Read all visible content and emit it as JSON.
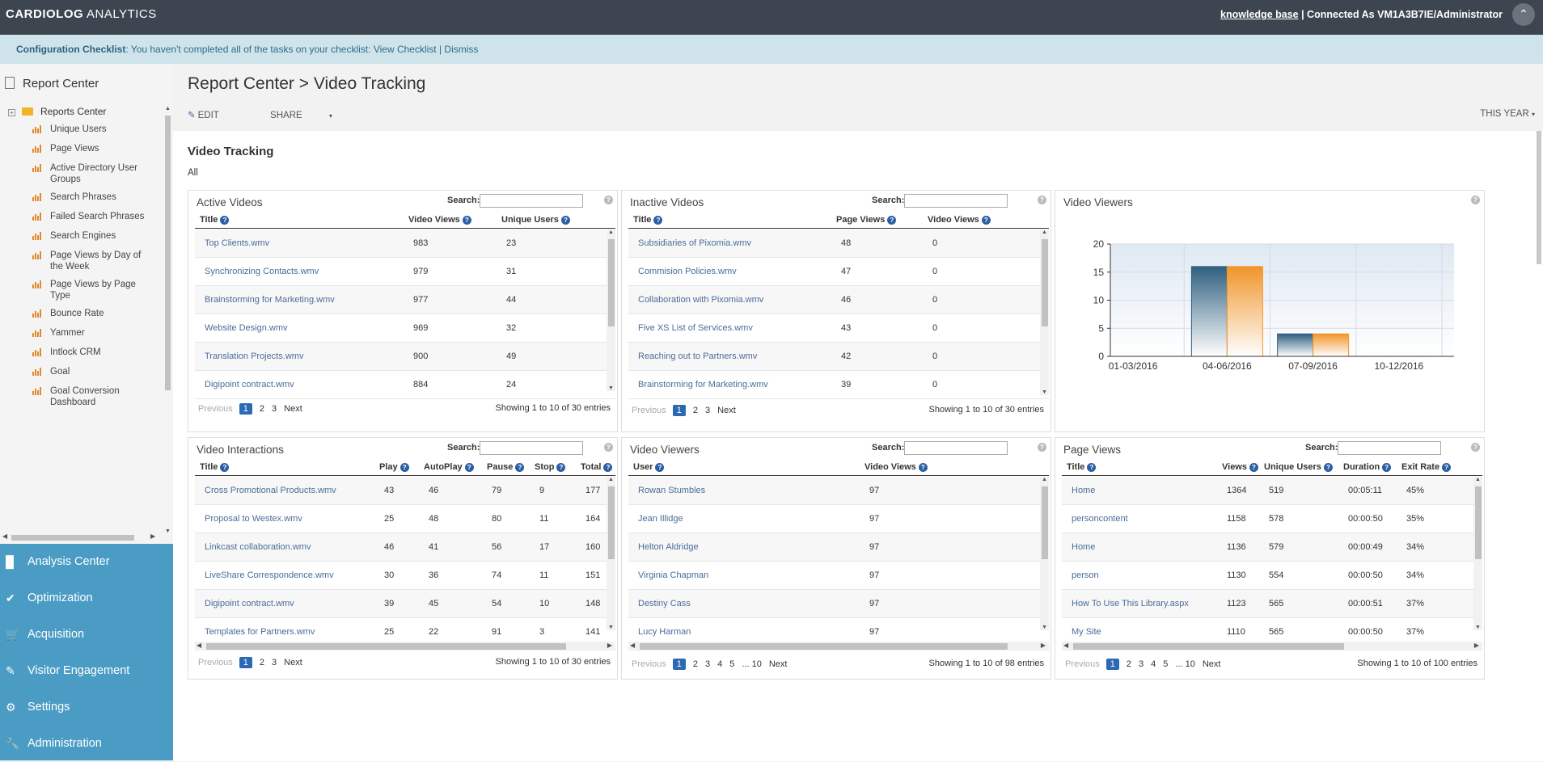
{
  "header": {
    "brand_bold": "CARDIOLOG",
    "brand_rest": " ANALYTICS",
    "kb_link": "knowledge base",
    "connected": " | Connected As VM1A3B7IE/Administrator"
  },
  "checklist": {
    "label": "Configuration Checklist",
    "text": ": You haven't completed all of the tasks on your checklist: ",
    "view": "View Checklist",
    "sep": " | ",
    "dismiss": "Dismiss"
  },
  "sidebar": {
    "title": "Report Center",
    "root": "Reports Center",
    "items": [
      {
        "label": "Unique Users"
      },
      {
        "label": "Page Views"
      },
      {
        "label": "Active Directory User Groups"
      },
      {
        "label": "Search Phrases"
      },
      {
        "label": "Failed Search Phrases"
      },
      {
        "label": "Search Engines"
      },
      {
        "label": "Page Views by Day of the Week"
      },
      {
        "label": "Page Views by Page Type"
      },
      {
        "label": "Bounce Rate"
      },
      {
        "label": "Yammer"
      },
      {
        "label": "Intlock CRM"
      },
      {
        "label": "Goal"
      },
      {
        "label": "Goal Conversion Dashboard"
      }
    ],
    "nav": [
      {
        "label": "Analysis Center",
        "icon": "bar-chart-icon"
      },
      {
        "label": "Optimization",
        "icon": "checkmark-icon"
      },
      {
        "label": "Acquisition",
        "icon": "cart-icon"
      },
      {
        "label": "Visitor Engagement",
        "icon": "pencil-icon"
      },
      {
        "label": "Settings",
        "icon": "gears-icon"
      },
      {
        "label": "Administration",
        "icon": "wrench-icon"
      }
    ]
  },
  "page": {
    "title": "Report Center > Video Tracking",
    "edit": "EDIT",
    "share": "SHARE",
    "range": "THIS YEAR",
    "section_title": "Video Tracking",
    "filter": "All"
  },
  "search_label": "Search:",
  "pager": {
    "prev": "Previous",
    "next": "Next",
    "ellipsis": "..."
  },
  "active_videos": {
    "title": "Active Videos",
    "headers": [
      "Title",
      "Video Views",
      "Unique Users"
    ],
    "rows": [
      [
        "Top Clients.wmv",
        "983",
        "23"
      ],
      [
        "Synchronizing Contacts.wmv",
        "979",
        "31"
      ],
      [
        "Brainstorming for Marketing.wmv",
        "977",
        "44"
      ],
      [
        "Website Design.wmv",
        "969",
        "32"
      ],
      [
        "Translation Projects.wmv",
        "900",
        "49"
      ],
      [
        "Digipoint contract.wmv",
        "884",
        "24"
      ]
    ],
    "pages": [
      "1",
      "2",
      "3"
    ],
    "showing": "Showing 1 to 10 of 30 entries"
  },
  "inactive_videos": {
    "title": "Inactive Videos",
    "headers": [
      "Title",
      "Page Views",
      "Video Views"
    ],
    "rows": [
      [
        "Subsidiaries of Pixomia.wmv",
        "48",
        "0"
      ],
      [
        "Commision Policies.wmv",
        "47",
        "0"
      ],
      [
        "Collaboration with Pixomia.wmv",
        "46",
        "0"
      ],
      [
        "Five XS List of Services.wmv",
        "43",
        "0"
      ],
      [
        "Reaching out to Partners.wmv",
        "42",
        "0"
      ],
      [
        "Brainstorming for Marketing.wmv",
        "39",
        "0"
      ]
    ],
    "pages": [
      "1",
      "2",
      "3"
    ],
    "showing": "Showing 1 to 10 of 30 entries"
  },
  "video_viewers_chart": {
    "title": "Video Viewers"
  },
  "chart_data": {
    "type": "bar",
    "categories": [
      "01-03/2016",
      "04-06/2016",
      "07-09/2016",
      "10-12/2016"
    ],
    "series": [
      {
        "values": [
          0,
          16,
          4,
          0
        ],
        "color": "#2f5f80"
      },
      {
        "values": [
          0,
          16,
          4,
          0
        ],
        "color": "#f0952a"
      }
    ],
    "ylim": [
      0,
      20
    ],
    "yticks": [
      "0",
      "5",
      "10",
      "15",
      "20"
    ],
    "grid": true
  },
  "video_interactions": {
    "title": "Video Interactions",
    "headers": [
      "Title",
      "Play",
      "AutoPlay",
      "Pause",
      "Stop",
      "Total"
    ],
    "rows": [
      [
        "Cross Promotional Products.wmv",
        "43",
        "46",
        "79",
        "9",
        "177"
      ],
      [
        "Proposal to Westex.wmv",
        "25",
        "48",
        "80",
        "11",
        "164"
      ],
      [
        "Linkcast collaboration.wmv",
        "46",
        "41",
        "56",
        "17",
        "160"
      ],
      [
        "LiveShare Correspondence.wmv",
        "30",
        "36",
        "74",
        "11",
        "151"
      ],
      [
        "Digipoint contract.wmv",
        "39",
        "45",
        "54",
        "10",
        "148"
      ],
      [
        "Templates for Partners.wmv",
        "25",
        "22",
        "91",
        "3",
        "141"
      ]
    ],
    "pages": [
      "1",
      "2",
      "3"
    ],
    "showing": "Showing 1 to 10 of 30 entries"
  },
  "video_viewers": {
    "title": "Video Viewers",
    "headers": [
      "User",
      "Video Views"
    ],
    "rows": [
      [
        "Rowan Stumbles",
        "97"
      ],
      [
        "Jean Illidge",
        "97"
      ],
      [
        "Helton Aldridge",
        "97"
      ],
      [
        "Virginia Chapman",
        "97"
      ],
      [
        "Destiny Cass",
        "97"
      ],
      [
        "Lucy Harman",
        "97"
      ]
    ],
    "pages": [
      "1",
      "2",
      "3",
      "4",
      "5",
      "10"
    ],
    "showing": "Showing 1 to 10 of 98 entries"
  },
  "page_views": {
    "title": "Page Views",
    "headers": [
      "Title",
      "Views",
      "Unique Users",
      "Duration",
      "Exit Rate"
    ],
    "rows": [
      [
        "Home",
        "1364",
        "519",
        "00:05:11",
        "45%"
      ],
      [
        "personcontent",
        "1158",
        "578",
        "00:00:50",
        "35%"
      ],
      [
        "Home",
        "1136",
        "579",
        "00:00:49",
        "34%"
      ],
      [
        "person",
        "1130",
        "554",
        "00:00:50",
        "34%"
      ],
      [
        "How To Use This Library.aspx",
        "1123",
        "565",
        "00:00:51",
        "37%"
      ],
      [
        "My Site",
        "1110",
        "565",
        "00:00:50",
        "37%"
      ]
    ],
    "pages": [
      "1",
      "2",
      "3",
      "4",
      "5",
      "10"
    ],
    "showing": "Showing 1 to 10 of 100 entries"
  }
}
